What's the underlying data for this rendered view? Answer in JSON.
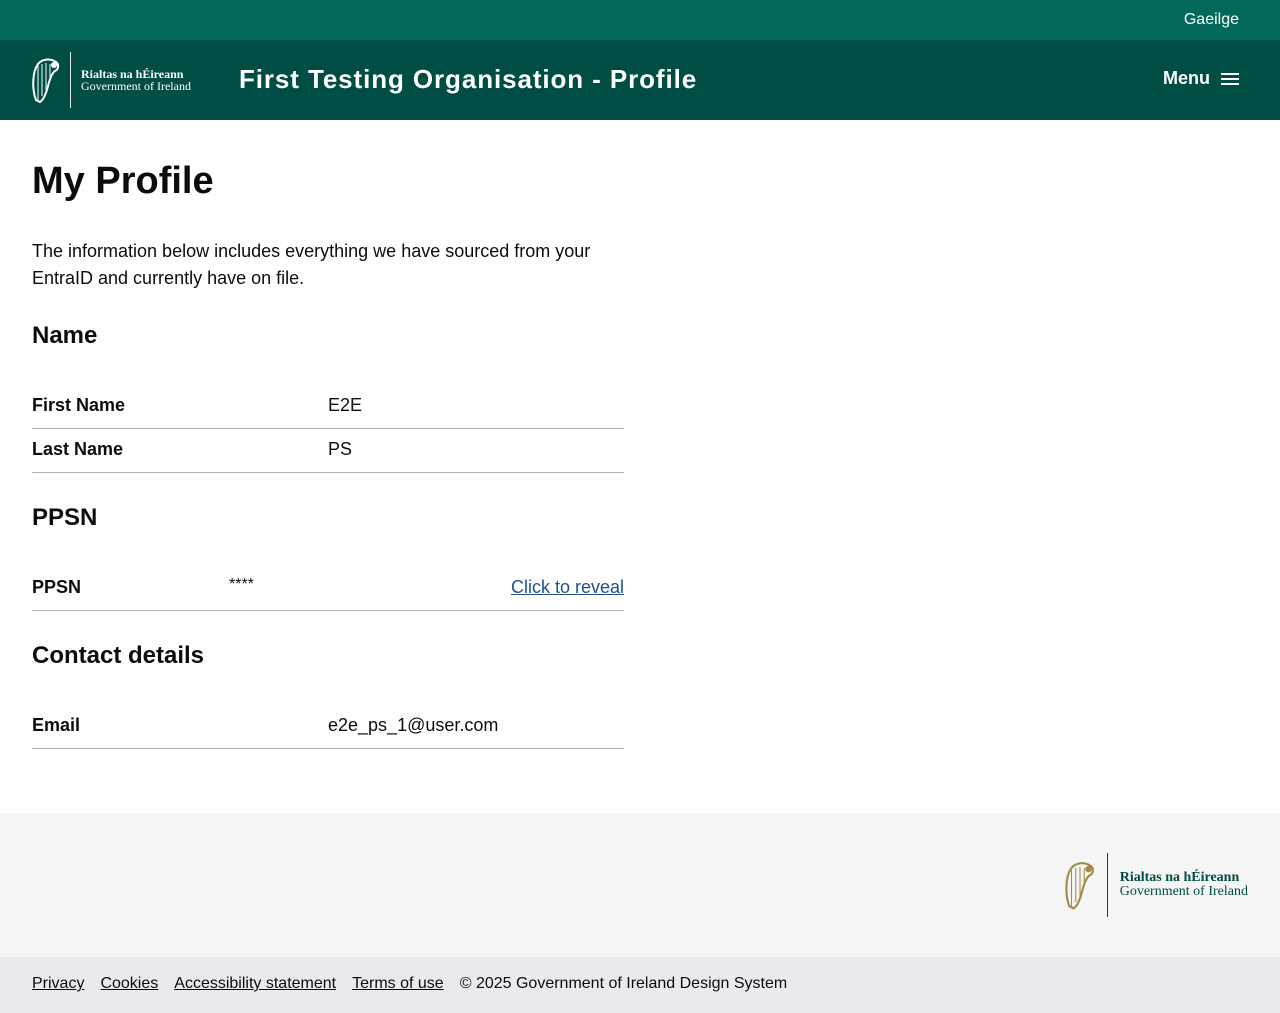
{
  "topbar": {
    "language_link": "Gaeilge"
  },
  "header": {
    "logo_line1": "Rialtas na hÉireann",
    "logo_line2": "Government of Ireland",
    "title": "First Testing Organisation - Profile",
    "menu_label": "Menu",
    "menu_icon": "hamburger-icon"
  },
  "main": {
    "page_title": "My Profile",
    "intro": "The information below includes everything we have sourced from your EntraID and currently have on file.",
    "sections": {
      "name": {
        "heading": "Name",
        "rows": [
          {
            "label": "First Name",
            "value": "E2E"
          },
          {
            "label": "Last Name",
            "value": "PS"
          }
        ]
      },
      "ppsn": {
        "heading": "PPSN",
        "label": "PPSN",
        "value": "****",
        "reveal_link": "Click to reveal"
      },
      "contact": {
        "heading": "Contact details",
        "rows": [
          {
            "label": "Email",
            "value": "e2e_ps_1@user.com"
          }
        ]
      }
    }
  },
  "footer": {
    "logo_line1": "Rialtas na hÉireann",
    "logo_line2": "Government of Ireland",
    "links": [
      "Privacy",
      "Cookies",
      "Accessibility statement",
      "Terms of use"
    ],
    "copyright": "© 2025 Government of Ireland Design System"
  },
  "colors": {
    "topbar": "#02695a",
    "header": "#004d44",
    "link": "#1d4f91",
    "footer_main": "#f5f5f5",
    "footer_bottom": "#e9eaed",
    "harp_gold": "#a08a4a"
  }
}
